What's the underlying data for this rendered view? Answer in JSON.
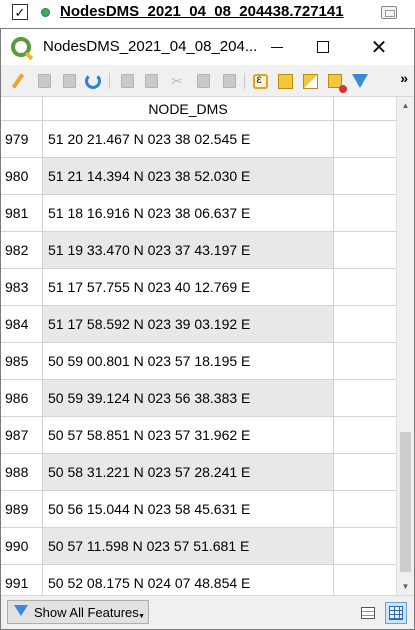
{
  "layer": {
    "checked_mark": "✓",
    "name": "NodesDMS_2021_04_08_204438.727141"
  },
  "window": {
    "title": "NodesDMS_2021_04_08_204...",
    "close_glyph": "✕"
  },
  "toolbar": {
    "icons": [
      "pencil-icon",
      "save-edits-icon",
      "save-icon",
      "reload-icon",
      "add-feature-icon",
      "delete-feature-icon",
      "cut-icon",
      "copy-icon",
      "paste-icon",
      "select-by-expression-icon",
      "select-all-icon",
      "invert-selection-icon",
      "deselect-icon",
      "filter-icon"
    ],
    "more_glyph": "»"
  },
  "table": {
    "column_header": "NODE_DMS",
    "rows": [
      {
        "id": "979",
        "value": "51 20 21.467 N 023 38 02.545 E"
      },
      {
        "id": "980",
        "value": "51 21 14.394 N 023 38 52.030 E"
      },
      {
        "id": "981",
        "value": "51 18 16.916 N 023 38 06.637 E"
      },
      {
        "id": "982",
        "value": "51 19 33.470 N 023 37 43.197 E"
      },
      {
        "id": "983",
        "value": "51 17 57.755 N 023 40 12.769 E"
      },
      {
        "id": "984",
        "value": "51 17 58.592 N 023 39 03.192 E"
      },
      {
        "id": "985",
        "value": "50 59 00.801 N 023 57 18.195 E"
      },
      {
        "id": "986",
        "value": "50 59 39.124 N 023 56 38.383 E"
      },
      {
        "id": "987",
        "value": "50 57 58.851 N 023 57 31.962 E"
      },
      {
        "id": "988",
        "value": "50 58 31.221 N 023 57 28.241 E"
      },
      {
        "id": "989",
        "value": "50 56 15.044 N 023 58 45.631 E"
      },
      {
        "id": "990",
        "value": "50 57 11.598 N 023 57 51.681 E"
      },
      {
        "id": "991",
        "value": "50 52 08.175 N 024 07 48.854 E"
      }
    ]
  },
  "scrollbar": {
    "up_glyph": "▲",
    "down_glyph": "▼"
  },
  "bottombar": {
    "filter_button_label": "Show All Features",
    "dropdown_glyph": "▼"
  }
}
